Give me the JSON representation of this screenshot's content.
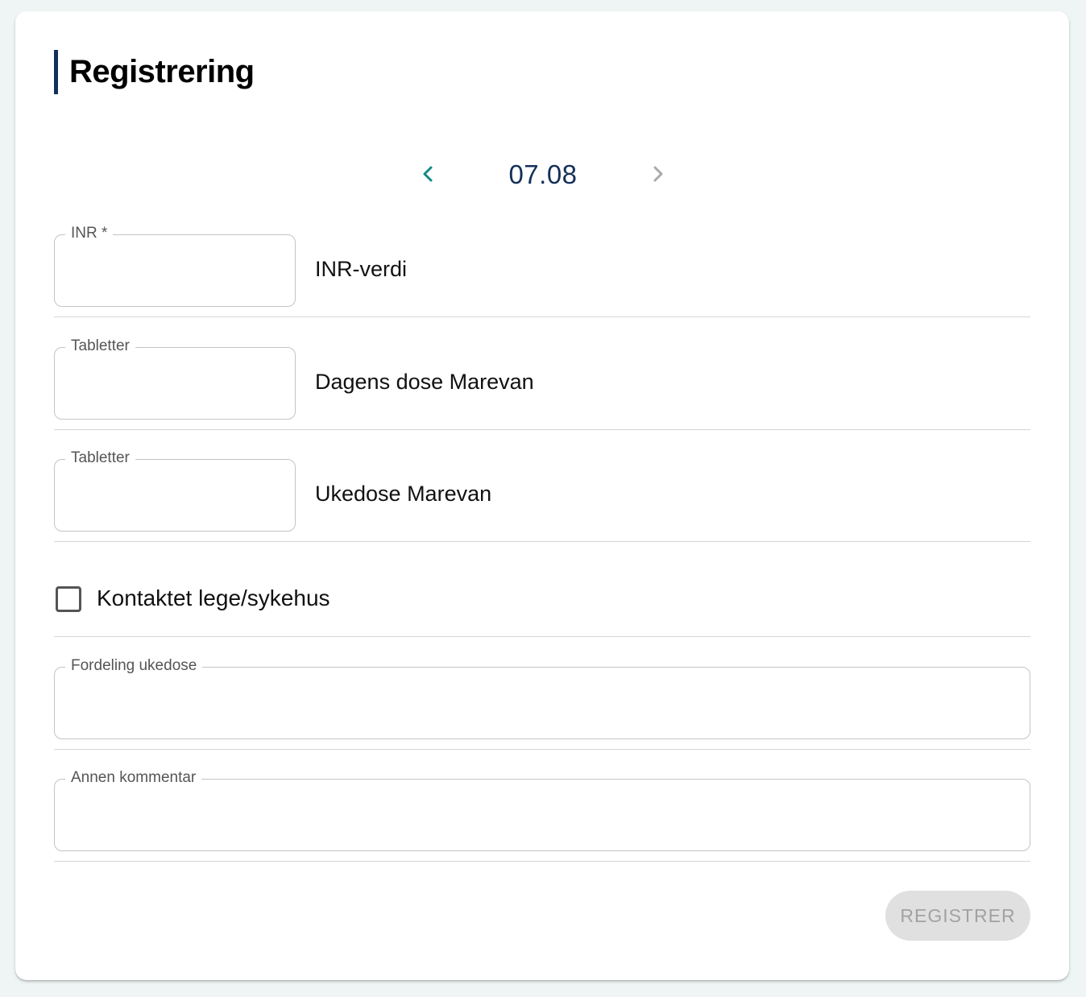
{
  "page": {
    "title": "Registrering"
  },
  "date_nav": {
    "date": "07.08",
    "prev_icon": "chevron-left-icon",
    "next_icon": "chevron-right-icon",
    "prev_color": "#138a84",
    "next_color": "#a9a9a9"
  },
  "rows": {
    "inr": {
      "legend": "INR *",
      "value": "",
      "description": "INR-verdi"
    },
    "daily": {
      "legend": "Tabletter",
      "value": "",
      "description": "Dagens dose Marevan"
    },
    "weekly": {
      "legend": "Tabletter",
      "value": "",
      "description": "Ukedose Marevan"
    }
  },
  "contact": {
    "label": "Kontaktet lege/sykehus",
    "checked": false
  },
  "distribution": {
    "legend": "Fordeling ukedose",
    "value": ""
  },
  "comment": {
    "legend": "Annen kommentar",
    "value": ""
  },
  "submit": {
    "label": "REGISTRER",
    "disabled": true
  }
}
